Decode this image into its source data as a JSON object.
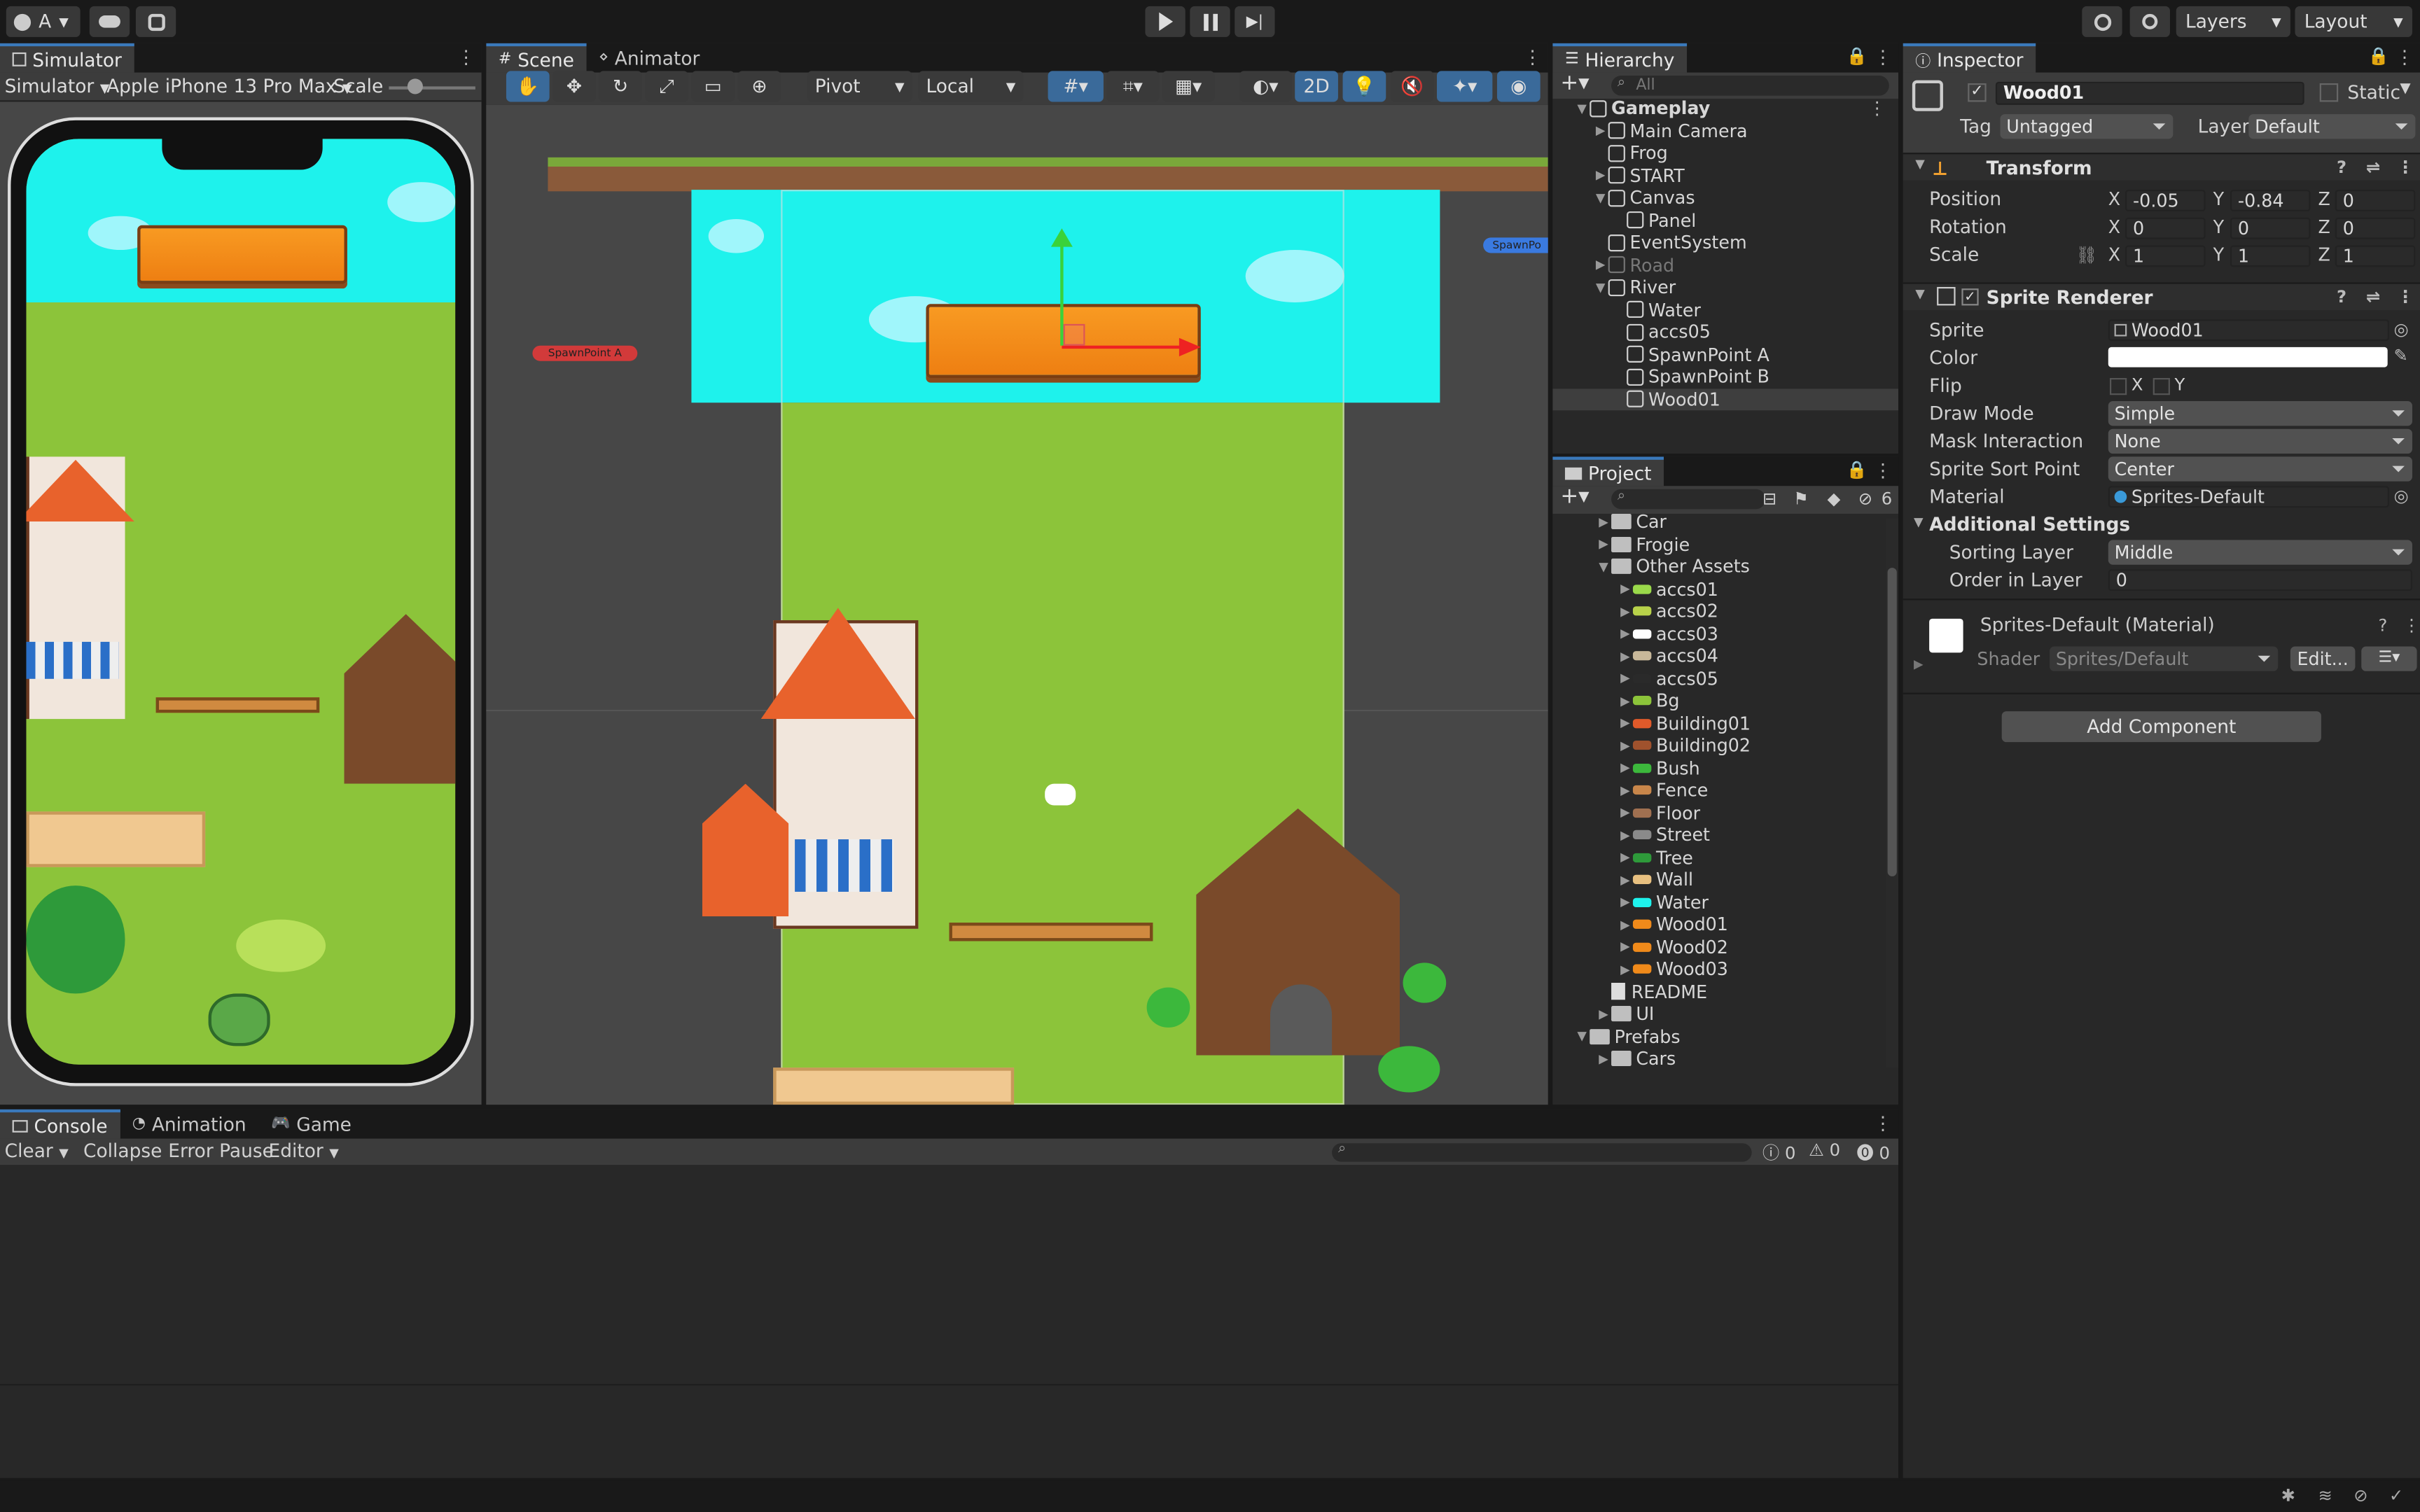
{
  "topbar": {
    "account": "A",
    "play_icon": "play-icon",
    "pause_icon": "pause-icon",
    "step_icon": "step-icon",
    "layers": "Layers",
    "layout": "Layout"
  },
  "simulator": {
    "tab": "Simulator",
    "mode": "Simulator",
    "device": "Apple iPhone 13 Pro Max",
    "scale_label": "Scale"
  },
  "scene": {
    "tabs": [
      "Scene",
      "Animator"
    ],
    "pivot": "Pivot",
    "local": "Local",
    "twod": "2D",
    "label_spawn_a": "SpawnPoint A",
    "label_spawn_b": "SpawnPo"
  },
  "hierarchy": {
    "title": "Hierarchy",
    "search_placeholder": "All",
    "items": [
      {
        "label": "Gameplay",
        "depth": 0,
        "arrow": "▼",
        "bold": true,
        "selected": false,
        "dim": false
      },
      {
        "label": "Main Camera",
        "depth": 1,
        "arrow": "▶",
        "bold": false,
        "selected": false,
        "dim": false
      },
      {
        "label": "Frog",
        "depth": 1,
        "arrow": "",
        "bold": false,
        "selected": false,
        "dim": false
      },
      {
        "label": "START",
        "depth": 1,
        "arrow": "▶",
        "bold": false,
        "selected": false,
        "dim": false
      },
      {
        "label": "Canvas",
        "depth": 1,
        "arrow": "▼",
        "bold": false,
        "selected": false,
        "dim": false
      },
      {
        "label": "Panel",
        "depth": 2,
        "arrow": "",
        "bold": false,
        "selected": false,
        "dim": false
      },
      {
        "label": "EventSystem",
        "depth": 1,
        "arrow": "",
        "bold": false,
        "selected": false,
        "dim": false
      },
      {
        "label": "Road",
        "depth": 1,
        "arrow": "▶",
        "bold": false,
        "selected": false,
        "dim": true
      },
      {
        "label": "River",
        "depth": 1,
        "arrow": "▼",
        "bold": false,
        "selected": false,
        "dim": false
      },
      {
        "label": "Water",
        "depth": 2,
        "arrow": "",
        "bold": false,
        "selected": false,
        "dim": false
      },
      {
        "label": "accs05",
        "depth": 2,
        "arrow": "",
        "bold": false,
        "selected": false,
        "dim": false
      },
      {
        "label": "SpawnPoint A",
        "depth": 2,
        "arrow": "",
        "bold": false,
        "selected": false,
        "dim": false
      },
      {
        "label": "SpawnPoint B",
        "depth": 2,
        "arrow": "",
        "bold": false,
        "selected": false,
        "dim": false
      },
      {
        "label": "Wood01",
        "depth": 2,
        "arrow": "",
        "bold": false,
        "selected": true,
        "dim": false
      }
    ]
  },
  "project": {
    "title": "Project",
    "hidden_count": "6",
    "items": [
      {
        "label": "Car",
        "depth": 1,
        "arrow": "▶",
        "kind": "folder",
        "color": "#bfbfbf"
      },
      {
        "label": "Frogie",
        "depth": 1,
        "arrow": "▶",
        "kind": "folder",
        "color": "#bfbfbf"
      },
      {
        "label": "Other Assets",
        "depth": 1,
        "arrow": "▼",
        "kind": "folder",
        "color": "#bfbfbf"
      },
      {
        "label": "accs01",
        "depth": 2,
        "arrow": "▶",
        "kind": "sprite",
        "color": "#9ad94a"
      },
      {
        "label": "accs02",
        "depth": 2,
        "arrow": "▶",
        "kind": "sprite",
        "color": "#b8d24a"
      },
      {
        "label": "accs03",
        "depth": 2,
        "arrow": "▶",
        "kind": "sprite",
        "color": "#ffffff"
      },
      {
        "label": "accs04",
        "depth": 2,
        "arrow": "▶",
        "kind": "sprite",
        "color": "#c8b89a"
      },
      {
        "label": "accs05",
        "depth": 2,
        "arrow": "▶",
        "kind": "sprite",
        "color": "#2a2a2a"
      },
      {
        "label": "Bg",
        "depth": 2,
        "arrow": "▶",
        "kind": "sprite",
        "color": "#8cc43a"
      },
      {
        "label": "Building01",
        "depth": 2,
        "arrow": "▶",
        "kind": "sprite",
        "color": "#e05a2a"
      },
      {
        "label": "Building02",
        "depth": 2,
        "arrow": "▶",
        "kind": "sprite",
        "color": "#a0522d"
      },
      {
        "label": "Bush",
        "depth": 2,
        "arrow": "▶",
        "kind": "sprite",
        "color": "#3cb83c"
      },
      {
        "label": "Fence",
        "depth": 2,
        "arrow": "▶",
        "kind": "sprite",
        "color": "#c8864a"
      },
      {
        "label": "Floor",
        "depth": 2,
        "arrow": "▶",
        "kind": "sprite",
        "color": "#a07050"
      },
      {
        "label": "Street",
        "depth": 2,
        "arrow": "▶",
        "kind": "sprite",
        "color": "#8a8a8a"
      },
      {
        "label": "Tree",
        "depth": 2,
        "arrow": "▶",
        "kind": "sprite",
        "color": "#2e9a3a"
      },
      {
        "label": "Wall",
        "depth": 2,
        "arrow": "▶",
        "kind": "sprite",
        "color": "#e8c080"
      },
      {
        "label": "Water",
        "depth": 2,
        "arrow": "▶",
        "kind": "sprite",
        "color": "#1ef2ec"
      },
      {
        "label": "Wood01",
        "depth": 2,
        "arrow": "▶",
        "kind": "sprite",
        "color": "#f08a1a"
      },
      {
        "label": "Wood02",
        "depth": 2,
        "arrow": "▶",
        "kind": "sprite",
        "color": "#f08a1a"
      },
      {
        "label": "Wood03",
        "depth": 2,
        "arrow": "▶",
        "kind": "sprite",
        "color": "#f08a1a"
      },
      {
        "label": "README",
        "depth": 1,
        "arrow": "",
        "kind": "doc",
        "color": "#dddddd"
      },
      {
        "label": "UI",
        "depth": 1,
        "arrow": "▶",
        "kind": "folder",
        "color": "#bfbfbf"
      },
      {
        "label": "Prefabs",
        "depth": 0,
        "arrow": "▼",
        "kind": "folder",
        "color": "#bfbfbf"
      },
      {
        "label": "Cars",
        "depth": 1,
        "arrow": "▶",
        "kind": "folder",
        "color": "#bfbfbf"
      }
    ]
  },
  "inspector": {
    "title": "Inspector",
    "object_name": "Wood01",
    "static_label": "Static",
    "tag_label": "Tag",
    "tag_value": "Untagged",
    "layer_label": "Layer",
    "layer_value": "Default",
    "transform": {
      "title": "Transform",
      "position_label": "Position",
      "rotation_label": "Rotation",
      "scale_label": "Scale",
      "position": {
        "x": "-0.05",
        "y": "-0.84",
        "z": "0"
      },
      "rotation": {
        "x": "0",
        "y": "0",
        "z": "0"
      },
      "scale": {
        "x": "1",
        "y": "1",
        "z": "1"
      }
    },
    "sprite_renderer": {
      "title": "Sprite Renderer",
      "sprite_label": "Sprite",
      "sprite_value": "Wood01",
      "color_label": "Color",
      "flip_label": "Flip",
      "flip_x": "X",
      "flip_y": "Y",
      "draw_mode_label": "Draw Mode",
      "draw_mode": "Simple",
      "mask_label": "Mask Interaction",
      "mask": "None",
      "sort_point_label": "Sprite Sort Point",
      "sort_point": "Center",
      "material_label": "Material",
      "material": "Sprites-Default",
      "additional": "Additional Settings",
      "sorting_layer_label": "Sorting Layer",
      "sorting_layer": "Middle",
      "order_label": "Order in Layer",
      "order": "0"
    },
    "material_block": {
      "title": "Sprites-Default (Material)",
      "shader_label": "Shader",
      "shader": "Sprites/Default",
      "edit": "Edit..."
    },
    "add_component": "Add Component",
    "axis_x": "X",
    "axis_y": "Y",
    "axis_z": "Z"
  },
  "bottom": {
    "tabs": [
      "Console",
      "Animation",
      "Game"
    ],
    "clear": "Clear",
    "collapse": "Collapse",
    "error_pause": "Error Pause",
    "editor": "Editor",
    "count_info": "0",
    "count_warn": "0",
    "count_error": "0"
  },
  "colors": {
    "accent": "#3a79bb",
    "sky": "#1ef2ec",
    "grass": "#8cc43a",
    "wood": "#f08a1a"
  }
}
